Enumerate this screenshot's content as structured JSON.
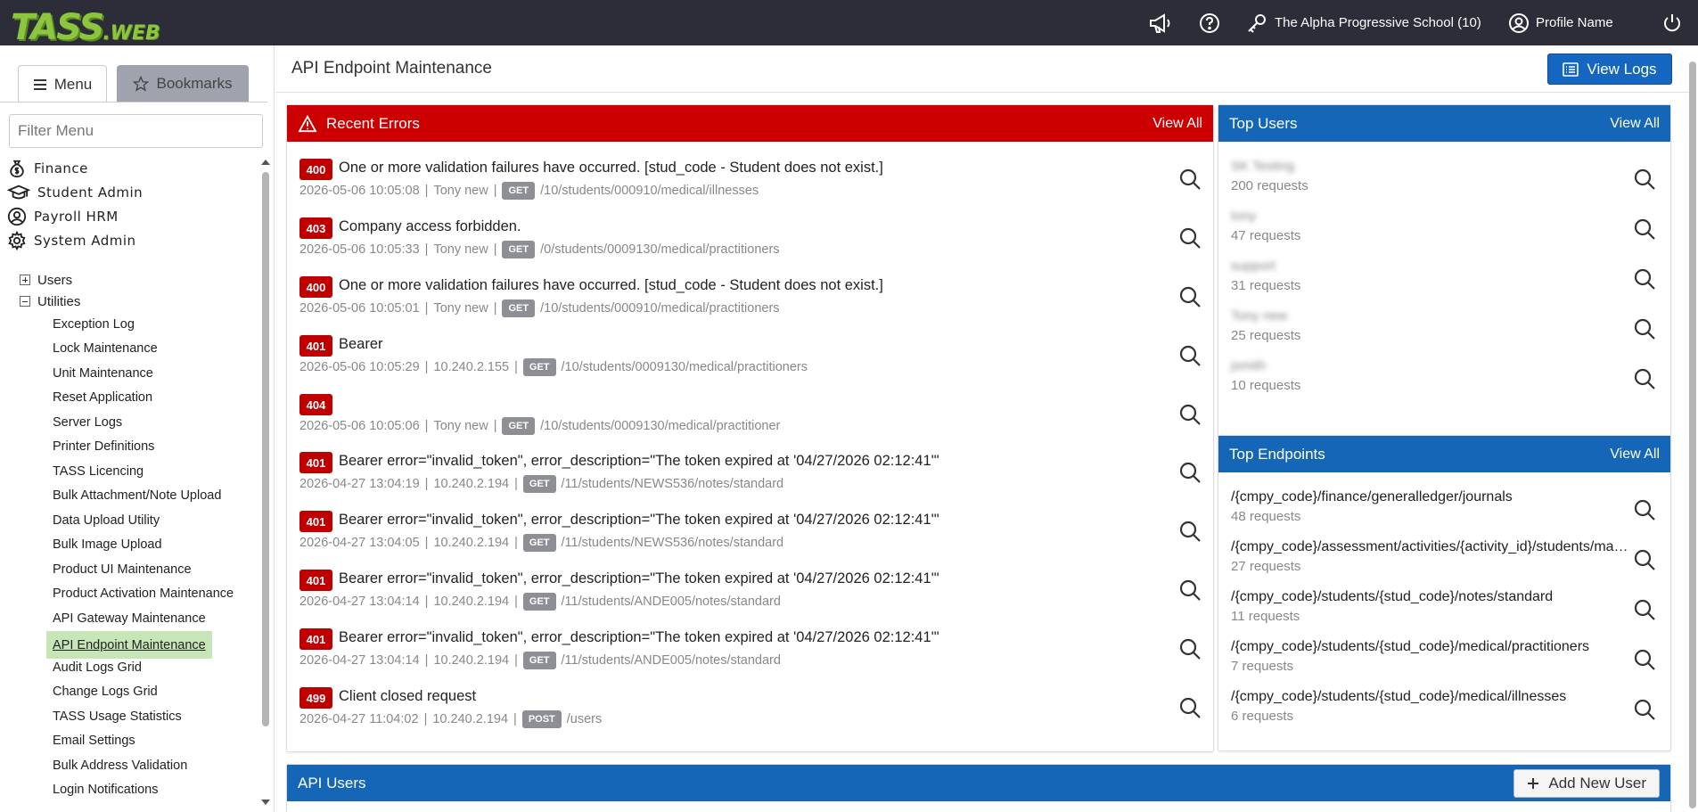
{
  "app": {
    "logo_big": "TASS",
    "logo_small": ".WEB",
    "school": "The Alpha Progressive School (10)",
    "profile": "Profile Name"
  },
  "sidebar": {
    "tab_menu": "Menu",
    "tab_bookmarks": "Bookmarks",
    "filter_placeholder": "Filter Menu",
    "top_items": [
      {
        "label": "Finance",
        "icon": "money-bag-icon"
      },
      {
        "label": "Student Admin",
        "icon": "graduation-cap-icon"
      },
      {
        "label": "Payroll HRM",
        "icon": "user-circle-icon"
      },
      {
        "label": "System Admin",
        "icon": "gear-icon"
      }
    ],
    "sub_items": [
      {
        "label": "Users",
        "state": "collapsed"
      },
      {
        "label": "Utilities",
        "state": "expanded"
      }
    ],
    "leaves": [
      "Exception Log",
      "Lock Maintenance",
      "Unit Maintenance",
      "Reset Application",
      "Server Logs",
      "Printer Definitions",
      "TASS Licencing",
      "Bulk Attachment/Note Upload",
      "Data Upload Utility",
      "Bulk Image Upload",
      "Product UI Maintenance",
      "Product Activation Maintenance",
      "API Gateway Maintenance",
      "API Endpoint Maintenance",
      "Audit Logs Grid",
      "Change Logs Grid",
      "TASS Usage Statistics",
      "Email Settings",
      "Bulk Address Validation",
      "Login Notifications"
    ],
    "active_leaf": "API Endpoint Maintenance"
  },
  "main": {
    "title": "API Endpoint Maintenance",
    "view_logs": "View Logs",
    "recent_errors": {
      "title": "Recent Errors",
      "view_all": "View All",
      "rows": [
        {
          "code": "400",
          "message": "One or more validation failures have occurred. [stud_code - Student does not exist.]",
          "time": "2026-05-06 10:05:08",
          "who": "Tony new",
          "method": "GET",
          "path": "/10/students/000910/medical/illnesses"
        },
        {
          "code": "403",
          "message": "Company access forbidden.",
          "time": "2026-05-06 10:05:33",
          "who": "Tony new",
          "method": "GET",
          "path": "/0/students/0009130/medical/practitioners"
        },
        {
          "code": "400",
          "message": "One or more validation failures have occurred. [stud_code - Student does not exist.]",
          "time": "2026-05-06 10:05:01",
          "who": "Tony new",
          "method": "GET",
          "path": "/10/students/000910/medical/practitioners"
        },
        {
          "code": "401",
          "message": "Bearer",
          "time": "2026-05-06 10:05:29",
          "who": "10.240.2.155",
          "method": "GET",
          "path": "/10/students/0009130/medical/practitioners"
        },
        {
          "code": "404",
          "message": "",
          "time": "2026-05-06 10:05:06",
          "who": "Tony new",
          "method": "GET",
          "path": "/10/students/0009130/medical/practitioner"
        },
        {
          "code": "401",
          "message": "Bearer error=\"invalid_token\", error_description=\"The token expired at '04/27/2026 02:12:41'\"",
          "time": "2026-04-27 13:04:19",
          "who": "10.240.2.194",
          "method": "GET",
          "path": "/11/students/NEWS536/notes/standard"
        },
        {
          "code": "401",
          "message": "Bearer error=\"invalid_token\", error_description=\"The token expired at '04/27/2026 02:12:41'\"",
          "time": "2026-04-27 13:04:05",
          "who": "10.240.2.194",
          "method": "GET",
          "path": "/11/students/NEWS536/notes/standard"
        },
        {
          "code": "401",
          "message": "Bearer error=\"invalid_token\", error_description=\"The token expired at '04/27/2026 02:12:41'\"",
          "time": "2026-04-27 13:04:14",
          "who": "10.240.2.194",
          "method": "GET",
          "path": "/11/students/ANDE005/notes/standard"
        },
        {
          "code": "401",
          "message": "Bearer error=\"invalid_token\", error_description=\"The token expired at '04/27/2026 02:12:41'\"",
          "time": "2026-04-27 13:04:14",
          "who": "10.240.2.194",
          "method": "GET",
          "path": "/11/students/ANDE005/notes/standard"
        },
        {
          "code": "499",
          "message": "Client closed request",
          "time": "2026-04-27 11:04:02",
          "who": "10.240.2.194",
          "method": "POST",
          "path": "/users"
        }
      ]
    },
    "top_users": {
      "title": "Top Users",
      "view_all": "View All",
      "rows": [
        {
          "name": "SK Testing",
          "requests": "200 requests"
        },
        {
          "name": "tony",
          "requests": "47 requests"
        },
        {
          "name": "support",
          "requests": "31 requests"
        },
        {
          "name": "Tony new",
          "requests": "25 requests"
        },
        {
          "name": "jsmith",
          "requests": "10 requests"
        }
      ]
    },
    "top_endpoints": {
      "title": "Top Endpoints",
      "view_all": "View All",
      "rows": [
        {
          "path": "/{cmpy_code}/finance/generalledger/journals",
          "requests": "48 requests"
        },
        {
          "path": "/{cmpy_code}/assessment/activities/{activity_id}/students/marks",
          "requests": "27 requests"
        },
        {
          "path": "/{cmpy_code}/students/{stud_code}/notes/standard",
          "requests": "11 requests"
        },
        {
          "path": "/{cmpy_code}/students/{stud_code}/medical/practitioners",
          "requests": "7 requests"
        },
        {
          "path": "/{cmpy_code}/students/{stud_code}/medical/illnesses",
          "requests": "6 requests"
        }
      ]
    },
    "api_users": {
      "title": "API Users",
      "add_button": "Add New User"
    }
  },
  "colors": {
    "topbar": "#2d2d3a",
    "error_red": "#cc0000",
    "primary_blue": "#1566b7",
    "logo_green": "#8cc63f",
    "active_menu": "#c6e6b8"
  }
}
